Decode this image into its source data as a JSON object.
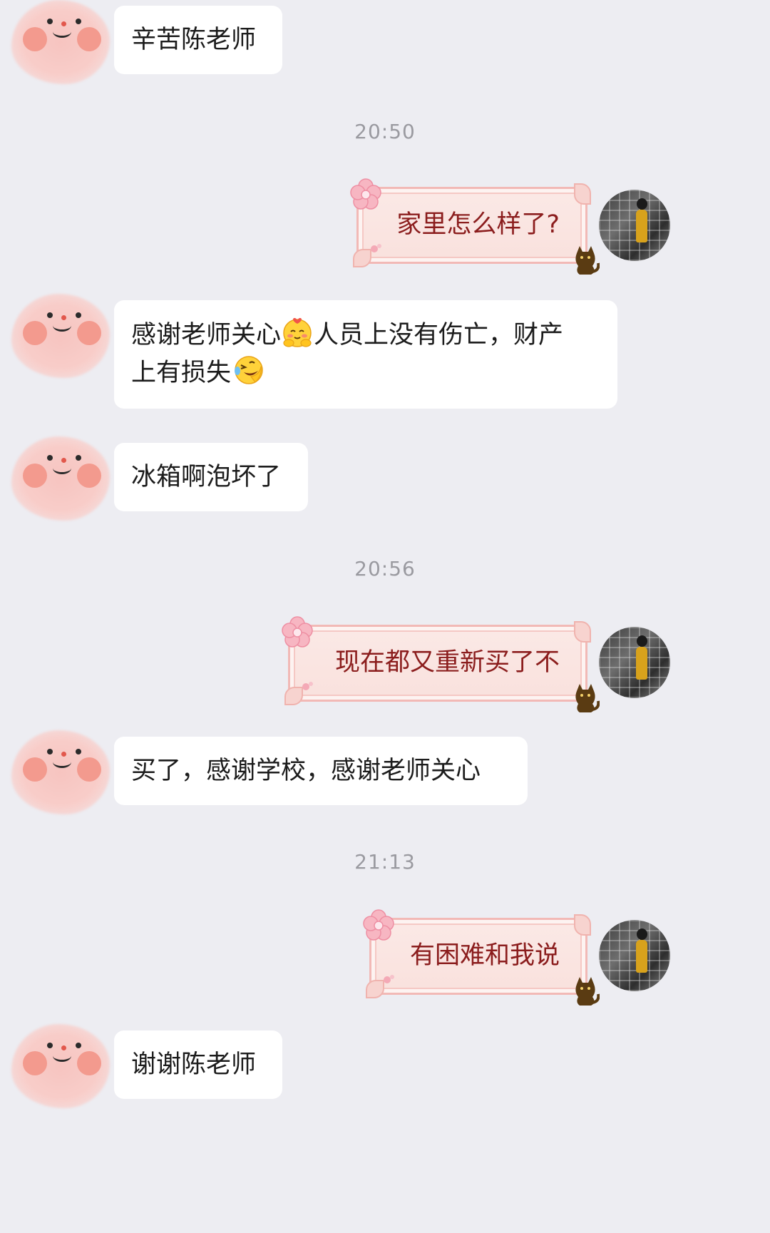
{
  "messages": [
    {
      "dir": "in",
      "text": "辛苦陈老师"
    },
    {
      "type": "time",
      "text": "20:50"
    },
    {
      "dir": "out",
      "text": "家里怎么样了?"
    },
    {
      "dir": "in",
      "text_a": "感谢老师关心",
      "emoji_a": "smiling-blush-emoji",
      "text_b": "人员上没有伤亡，财产",
      "text_c": "上有损失",
      "emoji_b": "laughing-tears-emoji"
    },
    {
      "dir": "in",
      "text": "冰箱啊泡坏了"
    },
    {
      "type": "time",
      "text": "20:56"
    },
    {
      "dir": "out",
      "text": "现在都又重新买了不"
    },
    {
      "dir": "in",
      "text": "买了，感谢学校，感谢老师关心"
    },
    {
      "type": "time",
      "text": "21:13"
    },
    {
      "dir": "out",
      "text": "有困难和我说"
    },
    {
      "dir": "in",
      "text": "谢谢陈老师"
    }
  ],
  "colors": {
    "background": "#ededf2",
    "incoming_bubble": "#ffffff",
    "outgoing_bubble": "#fbe9e6",
    "outgoing_text": "#8b1d1d",
    "timestamp": "#9a9aa0"
  },
  "icons": {
    "incoming_avatar": "pink-face-avatar",
    "outgoing_avatar": "photo-avatar",
    "bubble_decorations": [
      "flower-icon",
      "cat-icon",
      "petal-icon"
    ]
  }
}
